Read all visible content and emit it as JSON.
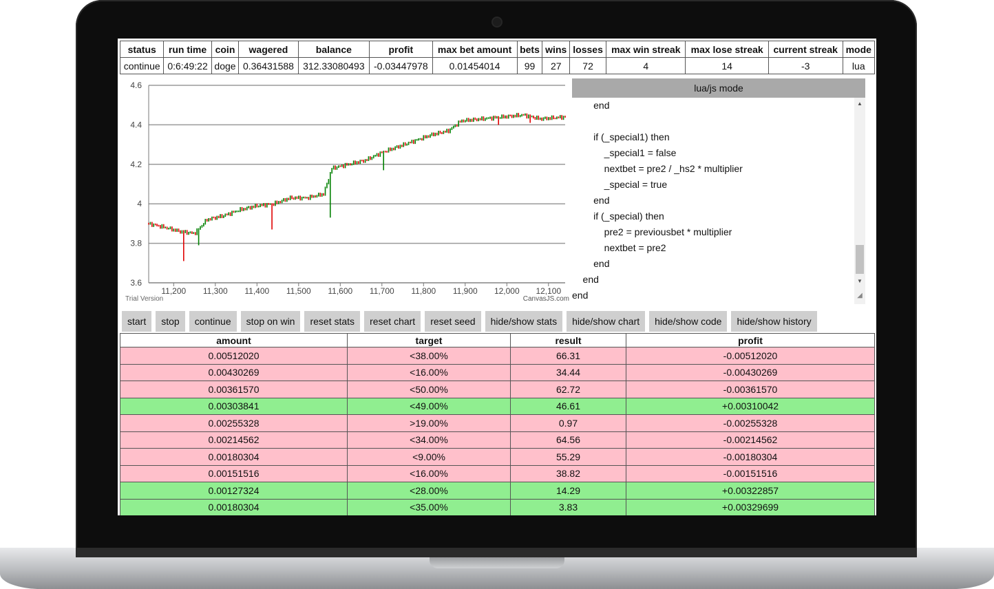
{
  "stats": {
    "headers": [
      "status",
      "run time",
      "coin",
      "wagered",
      "balance",
      "profit",
      "max bet amount",
      "bets",
      "wins",
      "losses",
      "max win streak",
      "max lose streak",
      "current streak",
      "mode"
    ],
    "values": [
      "continue",
      "0:6:49:22",
      "doge",
      "0.36431588",
      "312.33080493",
      "-0.03447978",
      "0.01454014",
      "99",
      "27",
      "72",
      "4",
      "14",
      "-3",
      "lua"
    ]
  },
  "chart_data": {
    "type": "candlestick",
    "y_ticks": [
      "3.6",
      "3.8",
      "4",
      "4.2",
      "4.4",
      "4.6"
    ],
    "x_ticks": [
      "11,200",
      "11,300",
      "11,400",
      "11,500",
      "11,600",
      "11,700",
      "11,800",
      "11,900",
      "12,000",
      "12,100"
    ],
    "ylim": [
      3.6,
      4.6
    ],
    "xlim": [
      11140,
      12140
    ],
    "grid": true,
    "colors": {
      "up": "#008000",
      "down": "#e00000"
    },
    "trend_points": [
      [
        11140,
        3.9
      ],
      [
        11180,
        3.88
      ],
      [
        11215,
        3.86
      ],
      [
        11250,
        3.85
      ],
      [
        11280,
        3.92
      ],
      [
        11320,
        3.94
      ],
      [
        11360,
        3.97
      ],
      [
        11400,
        3.99
      ],
      [
        11440,
        4.0
      ],
      [
        11480,
        4.03
      ],
      [
        11520,
        4.03
      ],
      [
        11560,
        4.05
      ],
      [
        11580,
        4.18
      ],
      [
        11620,
        4.2
      ],
      [
        11660,
        4.22
      ],
      [
        11700,
        4.26
      ],
      [
        11740,
        4.29
      ],
      [
        11780,
        4.32
      ],
      [
        11820,
        4.35
      ],
      [
        11860,
        4.37
      ],
      [
        11890,
        4.42
      ],
      [
        11940,
        4.43
      ],
      [
        11990,
        4.44
      ],
      [
        12040,
        4.45
      ],
      [
        12080,
        4.43
      ],
      [
        12140,
        4.44
      ]
    ],
    "dips": [
      [
        11225,
        3.71
      ],
      [
        11260,
        3.79
      ],
      [
        11435,
        3.87
      ],
      [
        11575,
        3.93
      ],
      [
        11705,
        4.17
      ],
      [
        11980,
        4.4
      ],
      [
        12055,
        4.41
      ]
    ],
    "trial_text": "Trial Version",
    "credit_text": "CanvasJS.com"
  },
  "code_editor": {
    "title": "lua/js mode",
    "lines": [
      "        end",
      "",
      "        if (_special1) then",
      "            _special1 = false",
      "            nextbet = pre2 / _hs2 * multiplier",
      "            _special = true",
      "        end",
      "        if (_special) then",
      "            pre2 = previousbet * multiplier",
      "            nextbet = pre2",
      "        end",
      "    end",
      "end"
    ],
    "scroll_up": "▲",
    "scroll_down": "▼",
    "grip": "◢"
  },
  "buttons": [
    "start",
    "stop",
    "continue",
    "stop on win",
    "reset stats",
    "reset chart",
    "reset seed",
    "hide/show stats",
    "hide/show chart",
    "hide/show code",
    "hide/show history"
  ],
  "history": {
    "headers": [
      "amount",
      "target",
      "result",
      "profit"
    ],
    "rows": [
      {
        "amount": "0.00512020",
        "target": "<38.00%",
        "result": "66.31",
        "profit": "-0.00512020",
        "status": "loss"
      },
      {
        "amount": "0.00430269",
        "target": "<16.00%",
        "result": "34.44",
        "profit": "-0.00430269",
        "status": "loss"
      },
      {
        "amount": "0.00361570",
        "target": "<50.00%",
        "result": "62.72",
        "profit": "-0.00361570",
        "status": "loss"
      },
      {
        "amount": "0.00303841",
        "target": "<49.00%",
        "result": "46.61",
        "profit": "+0.00310042",
        "status": "win"
      },
      {
        "amount": "0.00255328",
        "target": ">19.00%",
        "result": "0.97",
        "profit": "-0.00255328",
        "status": "loss"
      },
      {
        "amount": "0.00214562",
        "target": "<34.00%",
        "result": "64.56",
        "profit": "-0.00214562",
        "status": "loss"
      },
      {
        "amount": "0.00180304",
        "target": "<9.00%",
        "result": "55.29",
        "profit": "-0.00180304",
        "status": "loss"
      },
      {
        "amount": "0.00151516",
        "target": "<16.00%",
        "result": "38.82",
        "profit": "-0.00151516",
        "status": "loss"
      },
      {
        "amount": "0.00127324",
        "target": "<28.00%",
        "result": "14.29",
        "profit": "+0.00322857",
        "status": "win"
      },
      {
        "amount": "0.00180304",
        "target": "<35.00%",
        "result": "3.83",
        "profit": "+0.00329699",
        "status": "win"
      }
    ]
  }
}
